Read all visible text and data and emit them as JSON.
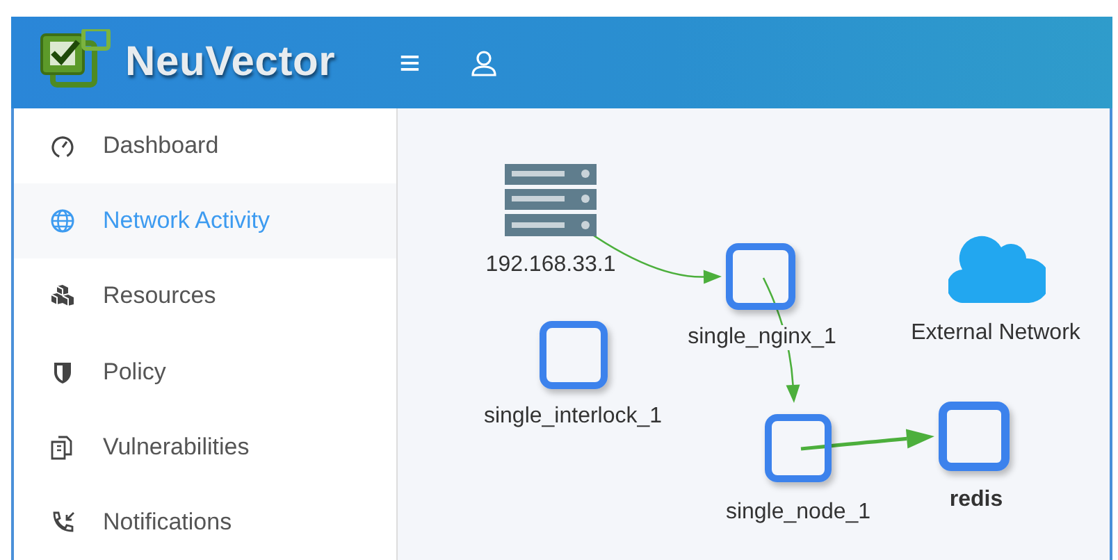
{
  "header": {
    "brand": "NeuVector",
    "menu_icon": "≡"
  },
  "sidebar": {
    "items": [
      {
        "kind": "gauge",
        "label": "Dashboard",
        "selected": false
      },
      {
        "kind": "globe",
        "label": "Network Activity",
        "selected": true
      },
      {
        "kind": "cubes",
        "label": "Resources",
        "selected": false
      },
      {
        "kind": "shield",
        "label": "Policy",
        "selected": false
      },
      {
        "kind": "documents",
        "label": "Vulnerabilities",
        "selected": false
      },
      {
        "kind": "phone",
        "label": "Notifications",
        "selected": false
      }
    ]
  },
  "graph": {
    "nodes": [
      {
        "kind": "host",
        "label": "192.168.33.1",
        "highlighted": false
      },
      {
        "kind": "workload",
        "label": "single_nginx_1",
        "highlighted": false
      },
      {
        "kind": "cloud",
        "label": "External Network",
        "highlighted": false
      },
      {
        "kind": "workload",
        "label": "single_interlock_1",
        "highlighted": false
      },
      {
        "kind": "workload",
        "label": "single_node_1",
        "highlighted": false
      },
      {
        "kind": "workload",
        "label": "redis",
        "highlighted": true
      }
    ],
    "edges": [
      {
        "kind": "thin"
      },
      {
        "kind": "thin"
      },
      {
        "kind": "thick"
      }
    ]
  }
}
